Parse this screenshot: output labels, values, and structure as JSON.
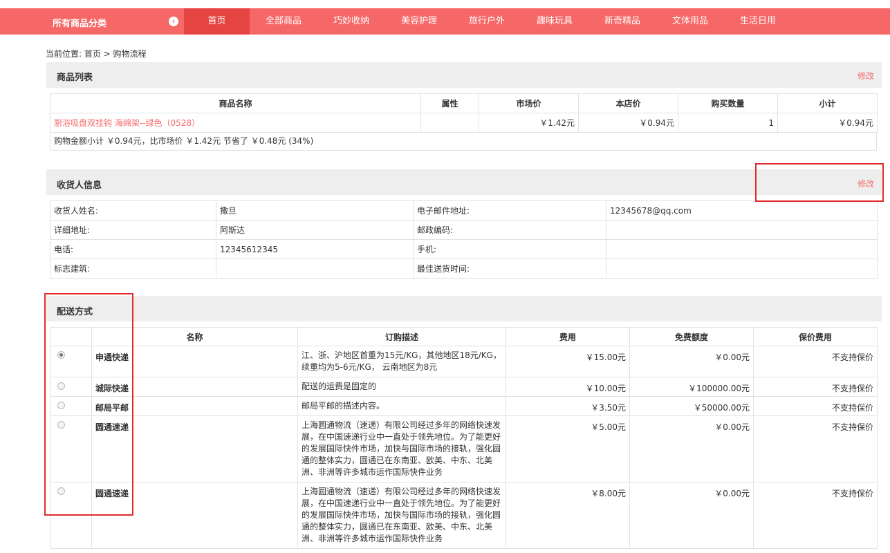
{
  "nav": {
    "all_categories": "所有商品分类",
    "items": [
      "首页",
      "全部商品",
      "巧妙收纳",
      "美容护理",
      "旅行户外",
      "趣味玩具",
      "新奇精品",
      "文体用品",
      "生活日用"
    ],
    "active": "首页"
  },
  "breadcrumb": "当前位置: 首页 > 购物流程",
  "goods": {
    "title": "商品列表",
    "edit": "修改",
    "headers": [
      "商品名称",
      "属性",
      "市场价",
      "本店价",
      "购买数量",
      "小计"
    ],
    "rows": [
      {
        "name": "厨浴吸盘双挂钩 海绵架--绿色（0528）",
        "attr": "",
        "market": "￥1.42元",
        "price": "￥0.94元",
        "qty": "1",
        "subtotal": "￥0.94元"
      }
    ],
    "summary": "购物金额小计 ￥0.94元，比市场价 ￥1.42元 节省了 ￥0.48元 (34%)"
  },
  "consignee": {
    "title": "收货人信息",
    "edit": "修改",
    "rows": [
      [
        "收货人姓名:",
        "撒旦",
        "电子邮件地址:",
        "12345678@qq.com"
      ],
      [
        "详细地址:",
        "阿斯达",
        "邮政编码:",
        ""
      ],
      [
        "电话:",
        "12345612345",
        "手机:",
        ""
      ],
      [
        "标志建筑:",
        "",
        "最佳送货时间:",
        ""
      ]
    ]
  },
  "shipping": {
    "title": "配送方式",
    "headers": [
      "",
      "名称",
      "订购描述",
      "费用",
      "免费额度",
      "保价费用"
    ],
    "rows": [
      {
        "checked": true,
        "name": "申通快递",
        "desc": "江、浙、沪地区首重为15元/KG，其他地区18元/KG，续重均为5-6元/KG， 云南地区为8元",
        "fee": "￥15.00元",
        "free": "￥0.00元",
        "insure": "不支持保价"
      },
      {
        "checked": false,
        "name": "城际快递",
        "desc": "配送的运费是固定的",
        "fee": "￥10.00元",
        "free": "￥100000.00元",
        "insure": "不支持保价"
      },
      {
        "checked": false,
        "name": "邮局平邮",
        "desc": "邮局平邮的描述内容。",
        "fee": "￥3.50元",
        "free": "￥50000.00元",
        "insure": "不支持保价"
      },
      {
        "checked": false,
        "name": "圆通速递",
        "desc": "上海圆通物流（速递）有限公司经过多年的网络快速发展，在中国速递行业中一直处于领先地位。为了能更好的发展国际快件市场，加快与国际市场的接轨，强化圆通的整体实力，圆通已在东南亚、欧美、中东、北美洲、非洲等许多城市运作国际快件业务",
        "fee": "￥5.00元",
        "free": "￥0.00元",
        "insure": "不支持保价"
      },
      {
        "checked": false,
        "name": "圆通速递",
        "desc": "上海圆通物流（速递）有限公司经过多年的网络快速发展，在中国速递行业中一直处于领先地位。为了能更好的发展国际快件市场，加快与国际市场的接轨，强化圆通的整体实力，圆通已在东南亚、欧美、中东、北美洲、非洲等许多城市运作国际快件业务",
        "fee": "￥8.00元",
        "free": "￥0.00元",
        "insure": "不支持保价"
      }
    ]
  },
  "colors": {
    "brand": "#f66767",
    "nav_active": "#e64343",
    "highlight_box": "#e32b2b"
  }
}
